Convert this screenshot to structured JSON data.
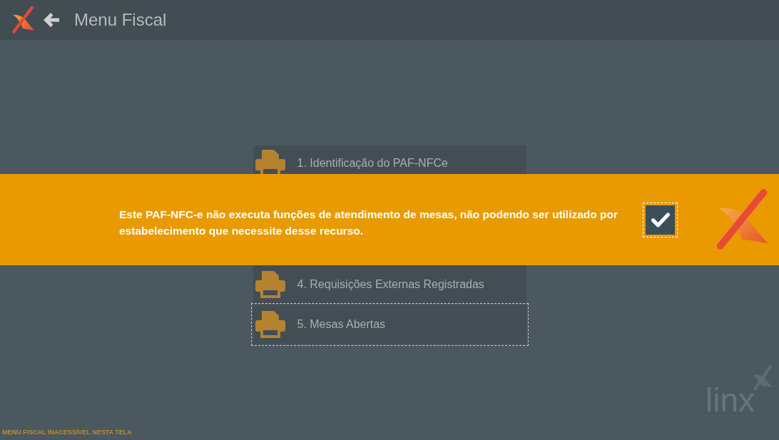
{
  "header": {
    "title": "Menu Fiscal"
  },
  "menu": {
    "items": [
      {
        "label": "1. Identificação do PAF-NFCe",
        "focused": false
      },
      {
        "label": "4. Requisições Externas Registradas",
        "focused": false
      },
      {
        "label": "5. Mesas Abertas",
        "focused": true
      }
    ]
  },
  "notice": {
    "message": "Este PAF-NFC-e não executa funções de atendimento de mesas, não podendo ser utilizado por estabelecimento que necessite desse recurso.",
    "checkbox": {
      "checked": true,
      "focused": true
    }
  },
  "brand": {
    "wordmark": "linx"
  },
  "status_bar": {
    "text": "MENU FISCAL INACESSÍVEL NESTA TELA"
  }
}
